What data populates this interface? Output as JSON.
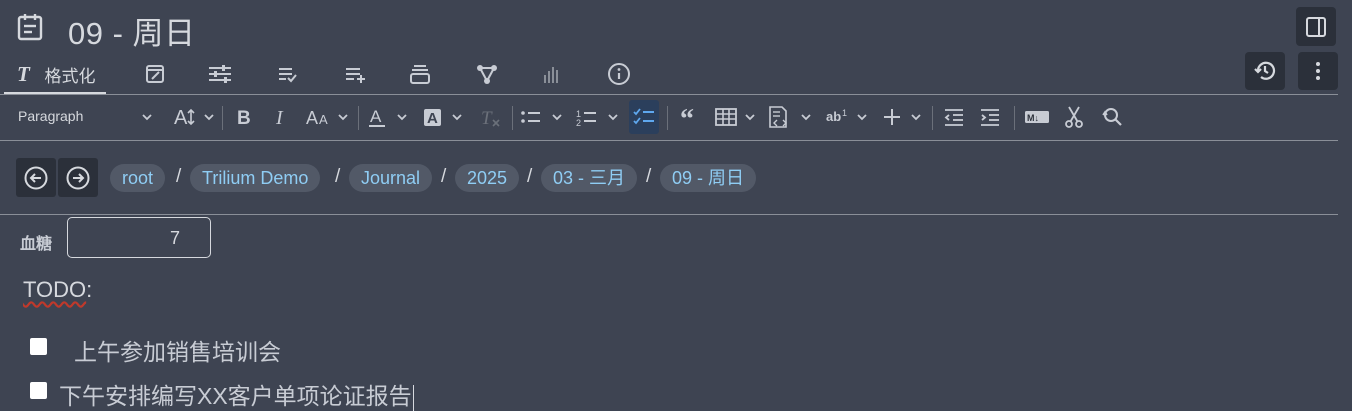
{
  "title": {
    "text": "09 - 周日",
    "icon": "calendar-note-icon"
  },
  "ribbon": {
    "active_tab_label": "格式化",
    "tabs": [
      "text-format-icon",
      "edit-note-icon",
      "sliders-icon",
      "checklist-icon",
      "add-list-icon",
      "stack-icon",
      "graph-icon",
      "chart-icon",
      "info-icon"
    ]
  },
  "toolbar": {
    "paragraph_label": "Paragraph"
  },
  "breadcrumb": {
    "items": [
      "root",
      "Trilium Demo",
      "Journal",
      "2025",
      "03 - 三月",
      "09 - 周日"
    ],
    "separator": "/"
  },
  "attribute": {
    "label": "血糖",
    "value": "7"
  },
  "content": {
    "heading": "TODO",
    "heading_suffix": ":",
    "tasks": [
      {
        "text": "上午参加销售培训会",
        "checked": false
      },
      {
        "text": "下午安排编写XX客户单项论证报告",
        "checked": false
      }
    ]
  },
  "colors": {
    "background": "#3e4452",
    "link": "#8fcdf4",
    "button_bg": "#2b303a"
  }
}
